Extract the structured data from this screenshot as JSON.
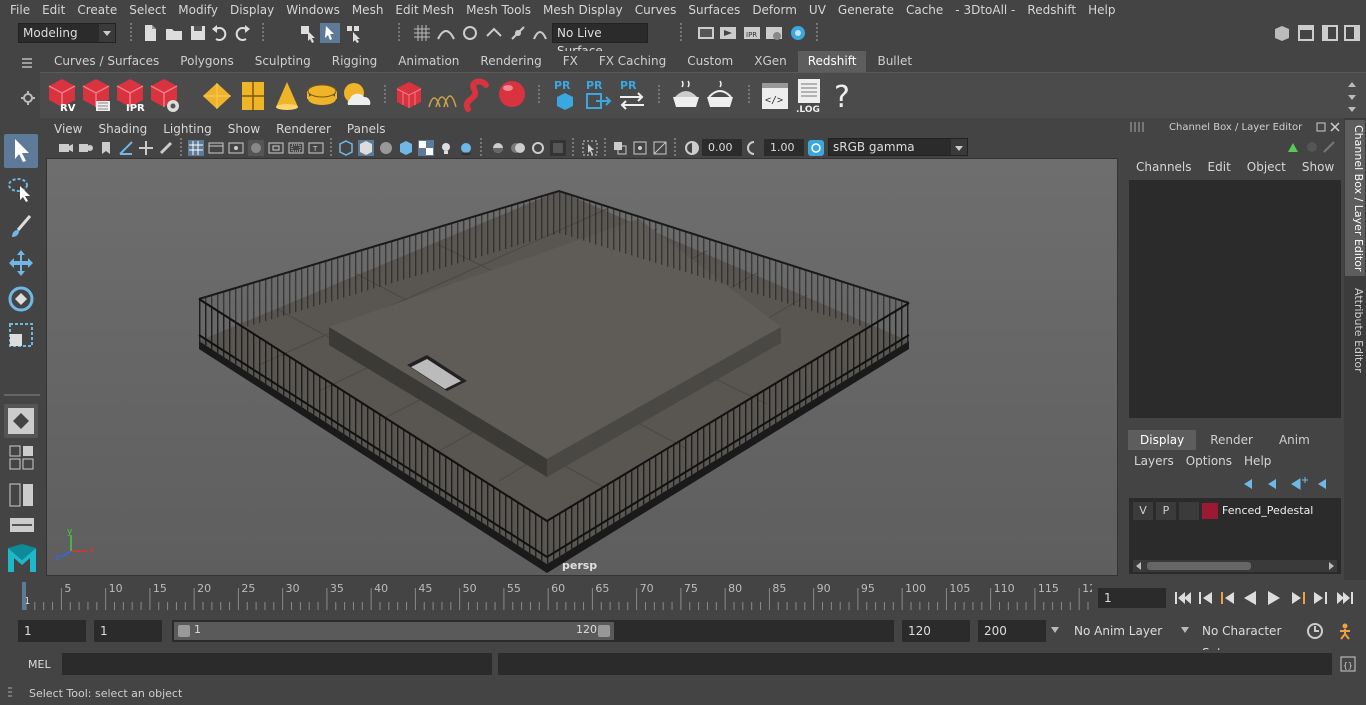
{
  "menu": [
    "File",
    "Edit",
    "Create",
    "Select",
    "Modify",
    "Display",
    "Windows",
    "Mesh",
    "Edit Mesh",
    "Mesh Tools",
    "Mesh Display",
    "Curves",
    "Surfaces",
    "Deform",
    "UV",
    "Generate",
    "Cache",
    "- 3DtoAll -",
    "Redshift",
    "Help"
  ],
  "status": {
    "mode": "Modeling",
    "live_surface": "No Live Surface"
  },
  "shelf_tabs": [
    "Curves / Surfaces",
    "Polygons",
    "Sculpting",
    "Rigging",
    "Animation",
    "Rendering",
    "FX",
    "FX Caching",
    "Custom",
    "XGen",
    "Redshift",
    "Bullet"
  ],
  "shelf_active": "Redshift",
  "shelf_icon_labels": {
    "rv": "RV",
    "ipr": "IPR",
    "pr": "PR",
    "log": ".LOG",
    "help": "?"
  },
  "viewport": {
    "menu": [
      "View",
      "Shading",
      "Lighting",
      "Show",
      "Renderer",
      "Panels"
    ],
    "exposure": "0.00",
    "gamma": "1.00",
    "color_space": "sRGB gamma",
    "camera_label": "persp",
    "axis": {
      "x": "x",
      "y": "y",
      "z": "z"
    }
  },
  "channel_box": {
    "title": "Channel Box / Layer Editor",
    "menu": [
      "Channels",
      "Edit",
      "Object",
      "Show"
    ],
    "layer_tabs": [
      "Display",
      "Render",
      "Anim"
    ],
    "layer_menu": [
      "Layers",
      "Options",
      "Help"
    ],
    "layer": {
      "v": "V",
      "p": "P",
      "name": "Fenced_Pedestal",
      "color": "#9b1a33"
    }
  },
  "side_tabs": [
    "Channel Box / Layer Editor",
    "Attribute Editor"
  ],
  "time_slider": {
    "ticks": [
      "5",
      "10",
      "15",
      "20",
      "25",
      "30",
      "35",
      "40",
      "45",
      "50",
      "55",
      "60",
      "65",
      "70",
      "75",
      "80",
      "85",
      "90",
      "95",
      "100",
      "105",
      "110",
      "115",
      "12"
    ],
    "start_label": "1",
    "current_frame": "1"
  },
  "range": {
    "start": "1",
    "playback_start": "1",
    "range_start_label": "1",
    "range_end_label": "120",
    "playback_end": "120",
    "end": "200",
    "anim_layer": "No Anim Layer",
    "character_set": "No Character Set"
  },
  "command": {
    "label": "MEL"
  },
  "help_line": "Select Tool: select an object",
  "colors": {
    "accent": "#5d7a99",
    "redshift": "#d8333f",
    "pr_blue": "#3aa7e0",
    "gold": "#f0b428"
  }
}
